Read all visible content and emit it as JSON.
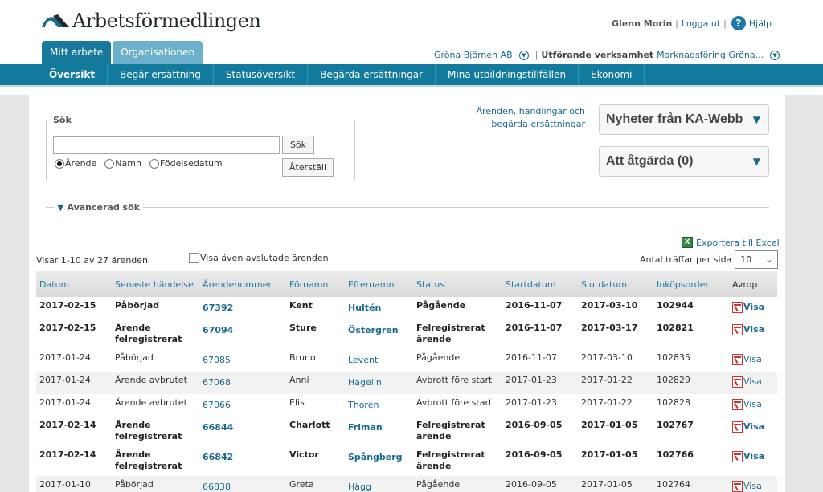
{
  "header": {
    "logo_text": "Arbetsförmedlingen",
    "user_name": "Glenn Morin",
    "logout_label": "Logga ut",
    "help_label": "Hjälp",
    "separator": "|"
  },
  "tabs": [
    {
      "label": "Mitt arbete",
      "active": true
    },
    {
      "label": "Organisationen",
      "active": false
    }
  ],
  "org_bar": {
    "organization": "Gröna Björnen AB",
    "separator": "|",
    "unit_label": "Utförande verksamhet",
    "unit_value": "Marknadsföring Gröna..."
  },
  "nav": [
    {
      "label": "Översikt",
      "active": true
    },
    {
      "label": "Begär ersättning"
    },
    {
      "label": "Statusöversikt"
    },
    {
      "label": "Begärda ersättningar"
    },
    {
      "label": "Mina utbildningstillfällen"
    },
    {
      "label": "Ekonomi"
    }
  ],
  "search": {
    "legend": "Sök",
    "input_value": "",
    "search_button": "Sök",
    "reset_button": "Återställ",
    "radios": [
      {
        "label": "Ärende",
        "checked": true
      },
      {
        "label": "Namn",
        "checked": false
      },
      {
        "label": "Födelsedatum",
        "checked": false
      }
    ],
    "advanced_label": "Avancerad sök"
  },
  "side_link": "Ärenden, handlingar och begärda ersättningar",
  "panels": {
    "news": "Nyheter från KA-Webb",
    "todo": "Att åtgärda (0)"
  },
  "list": {
    "export_label": "Exportera till Excel",
    "count_text": "Visar 1-10 av 27 ärenden",
    "show_closed_label": "Visa även avslutade ärenden",
    "show_closed_checked": false,
    "per_page_label": "Antal träffar per sida",
    "per_page_value": "10",
    "columns": [
      "Datum",
      "Senaste händelse",
      "Ärendenummer",
      "Förnamn",
      "Efternamn",
      "Status",
      "Startdatum",
      "Slutdatum",
      "Inköpsorder",
      "Avrop"
    ],
    "view_label": "Visa",
    "rows": [
      {
        "bold": true,
        "datum": "2017-02-15",
        "handelse": "Påbörjad",
        "nr": "67392",
        "fornamn": "Kent",
        "efternamn": "Hultén",
        "status": "Pågående",
        "start": "2016-11-07",
        "slut": "2017-03-10",
        "order": "102944"
      },
      {
        "bold": true,
        "datum": "2017-02-15",
        "handelse": "Ärende felregistrerat",
        "nr": "67094",
        "fornamn": "Sture",
        "efternamn": "Östergren",
        "status": "Felregistrerat ärende",
        "start": "2016-11-07",
        "slut": "2017-03-17",
        "order": "102821"
      },
      {
        "bold": false,
        "datum": "2017-01-24",
        "handelse": "Påbörjad",
        "nr": "67085",
        "fornamn": "Bruno",
        "efternamn": "Levent",
        "status": "Pågående",
        "start": "2016-11-07",
        "slut": "2017-03-10",
        "order": "102835"
      },
      {
        "bold": false,
        "datum": "2017-01-24",
        "handelse": "Ärende avbrutet",
        "nr": "67068",
        "fornamn": "Anni",
        "efternamn": "Hagelin",
        "status": "Avbrott före start",
        "start": "2017-01-23",
        "slut": "2017-01-22",
        "order": "102829"
      },
      {
        "bold": false,
        "datum": "2017-01-24",
        "handelse": "Ärende avbrutet",
        "nr": "67066",
        "fornamn": "Elis",
        "efternamn": "Thorén",
        "status": "Avbrott före start",
        "start": "2017-01-23",
        "slut": "2017-01-22",
        "order": "102828"
      },
      {
        "bold": true,
        "datum": "2017-02-14",
        "handelse": "Ärende felregistrerat",
        "nr": "66844",
        "fornamn": "Charlott",
        "efternamn": "Friman",
        "status": "Felregistrerat ärende",
        "start": "2016-09-05",
        "slut": "2017-01-05",
        "order": "102767"
      },
      {
        "bold": true,
        "datum": "2017-02-14",
        "handelse": "Ärende felregistrerat",
        "nr": "66842",
        "fornamn": "Victor",
        "efternamn": "Spångberg",
        "status": "Felregistrerat ärende",
        "start": "2016-09-05",
        "slut": "2017-01-05",
        "order": "102766"
      },
      {
        "bold": false,
        "datum": "2017-01-10",
        "handelse": "Påbörjad",
        "nr": "66838",
        "fornamn": "Greta",
        "efternamn": "Hägg",
        "status": "Pågående",
        "start": "2016-09-05",
        "slut": "2017-01-05",
        "order": "102764"
      }
    ]
  }
}
